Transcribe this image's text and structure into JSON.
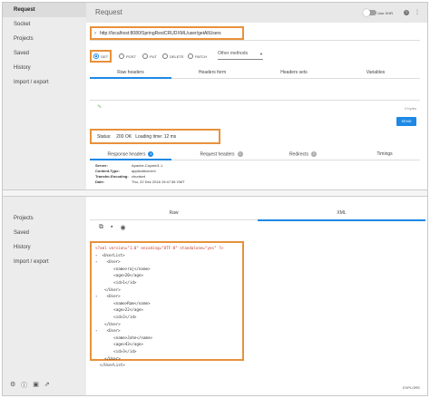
{
  "top": {
    "sidebar": [
      {
        "label": "Request"
      },
      {
        "label": "Socket"
      },
      {
        "label": "Projects"
      },
      {
        "label": "Saved"
      },
      {
        "label": "History"
      },
      {
        "label": "Import / export"
      }
    ],
    "title": "Request",
    "toggle_label": "Use XHR",
    "url": "http://localhost:8080/SpringRestCRUDXML/user/getAllUsers",
    "methods": [
      "GET",
      "POST",
      "PUT",
      "DELETE",
      "PATCH"
    ],
    "selected_method": "GET",
    "other_methods": "Other methods",
    "request_tabs": [
      "Raw headers",
      "Headers form",
      "Headers sets",
      "Variables"
    ],
    "bytes": "0 bytes",
    "send": "SEND",
    "status_label": "Status:",
    "status_value": "200  OK",
    "loading": "Loading time: 12 ms",
    "response_tabs": [
      {
        "label": "Response headers",
        "count": "4"
      },
      {
        "label": "Request headers",
        "count": "0"
      },
      {
        "label": "Redirects",
        "count": "0"
      },
      {
        "label": "Timings",
        "count": ""
      }
    ],
    "headers": [
      {
        "k": "Server:",
        "v": "Apache-Coyote/1.1"
      },
      {
        "k": "Content-Type:",
        "v": "application/xml"
      },
      {
        "k": "Transfer-Encoding:",
        "v": "chunked"
      },
      {
        "k": "Date:",
        "v": "Thu, 22 Dec 2016 19:47:36 GMT"
      }
    ]
  },
  "bottom": {
    "sidebar": [
      {
        "label": "Projects"
      },
      {
        "label": "Saved"
      },
      {
        "label": "History"
      },
      {
        "label": "Import / export"
      }
    ],
    "format_tabs": [
      "Raw",
      "XML"
    ],
    "xml_lines": [
      "<?xml version=\"1.0\" encoding=\"UTF-8\" standalone=\"yes\" ?>",
      "  <UserList>",
      "    <User>",
      "        <name>raj</name>",
      "        <age>20</age>",
      "        <id>1</id>",
      "    </User>",
      "    <User>",
      "        <name>Ram</name>",
      "        <age>22</age>",
      "        <id>2</id>",
      "    </User>",
      "    <User>",
      "        <name>John</name>",
      "        <age>43</age>",
      "        <id>3</id>",
      "    </User>",
      "  </UserList>"
    ],
    "explore": "EXPLORE"
  }
}
